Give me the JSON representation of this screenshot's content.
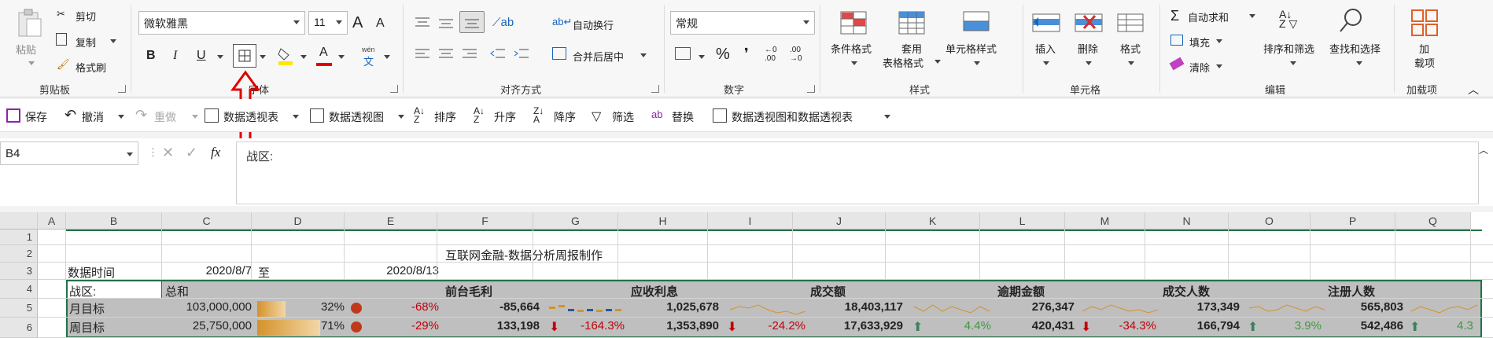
{
  "clipboard": {
    "paste": "粘贴",
    "cut": "剪切",
    "copy": "复制",
    "format_painter": "格式刷",
    "group": "剪贴板"
  },
  "font": {
    "name": "微软雅黑",
    "size": "11",
    "group": "字体",
    "bold": "B",
    "italic": "I",
    "underline": "U",
    "font_color_icon": "A",
    "grow": "A",
    "shrink": "A",
    "phonetic_top": "wén",
    "phonetic_bottom": "文"
  },
  "alignment": {
    "wrap": "自动换行",
    "merge": "合并后居中",
    "group": "对齐方式"
  },
  "number": {
    "format": "常规",
    "percent": "%",
    "comma": "❜",
    "group": "数字"
  },
  "styles": {
    "conditional": "条件格式",
    "table": "套用",
    "table2": "表格格式",
    "cell_styles": "单元格样式",
    "group": "样式"
  },
  "cells": {
    "insert": "插入",
    "delete": "删除",
    "format": "格式",
    "group": "单元格"
  },
  "editing": {
    "autosum": "自动求和",
    "fill": "填充",
    "clear": "清除",
    "sort_filter": "排序和筛选",
    "find_select": "查找和选择",
    "group": "编辑"
  },
  "addins": {
    "label1": "加",
    "label2": "载项",
    "group": "加载项"
  },
  "qat": {
    "save": "保存",
    "undo": "撤消",
    "redo": "重做",
    "pivot_table": "数据透视表",
    "pivot_chart": "数据透视图",
    "sort": "排序",
    "sort_asc": "升序",
    "sort_desc": "降序",
    "filter": "筛选",
    "replace": "替换",
    "pivot_both": "数据透视图和数据透视表"
  },
  "formula_bar": {
    "name_box": "B4",
    "fx": "fx",
    "content": "战区:"
  },
  "columns": [
    "A",
    "B",
    "C",
    "D",
    "E",
    "F",
    "G",
    "H",
    "I",
    "J",
    "K",
    "L",
    "M",
    "N",
    "O",
    "P",
    "Q"
  ],
  "rows": [
    "1",
    "2",
    "3",
    "4",
    "5",
    "6"
  ],
  "sheet": {
    "title": "互联网金融-数据分析周报制作",
    "date_label": "数据时间",
    "date_from": "2020/8/7",
    "to": "至",
    "date_to": "2020/8/13",
    "zone": "战区:",
    "total": "总和",
    "headers": [
      "前台毛利",
      "应收利息",
      "成交额",
      "逾期金额",
      "成交人数",
      "注册人数"
    ],
    "month_label": "月目标",
    "week_label": "周目标",
    "month_total": "103,000,000",
    "week_total": "25,750,000",
    "month_pct": "32%",
    "week_pct": "71%",
    "month_pct_value": 0.32,
    "week_pct_value": 0.71,
    "month_e": "-68%",
    "week_e": "-29%",
    "month_vals": [
      "-85,664",
      "1,025,678",
      "18,403,117",
      "276,347",
      "173,349",
      "565,803"
    ],
    "week_vals": [
      "133,198",
      "1,353,890",
      "17,633,929",
      "420,431",
      "166,794",
      "542,486"
    ],
    "week_changes": [
      "-164.3%",
      "-24.2%",
      "4.4%",
      "-34.3%",
      "3.9%",
      "4.3"
    ]
  },
  "colors": {
    "accent_green": "#217346",
    "bar_orange": "#d4922b",
    "red": "#c0000a",
    "green": "#3f9a3f",
    "arrow_red": "#c00000"
  }
}
